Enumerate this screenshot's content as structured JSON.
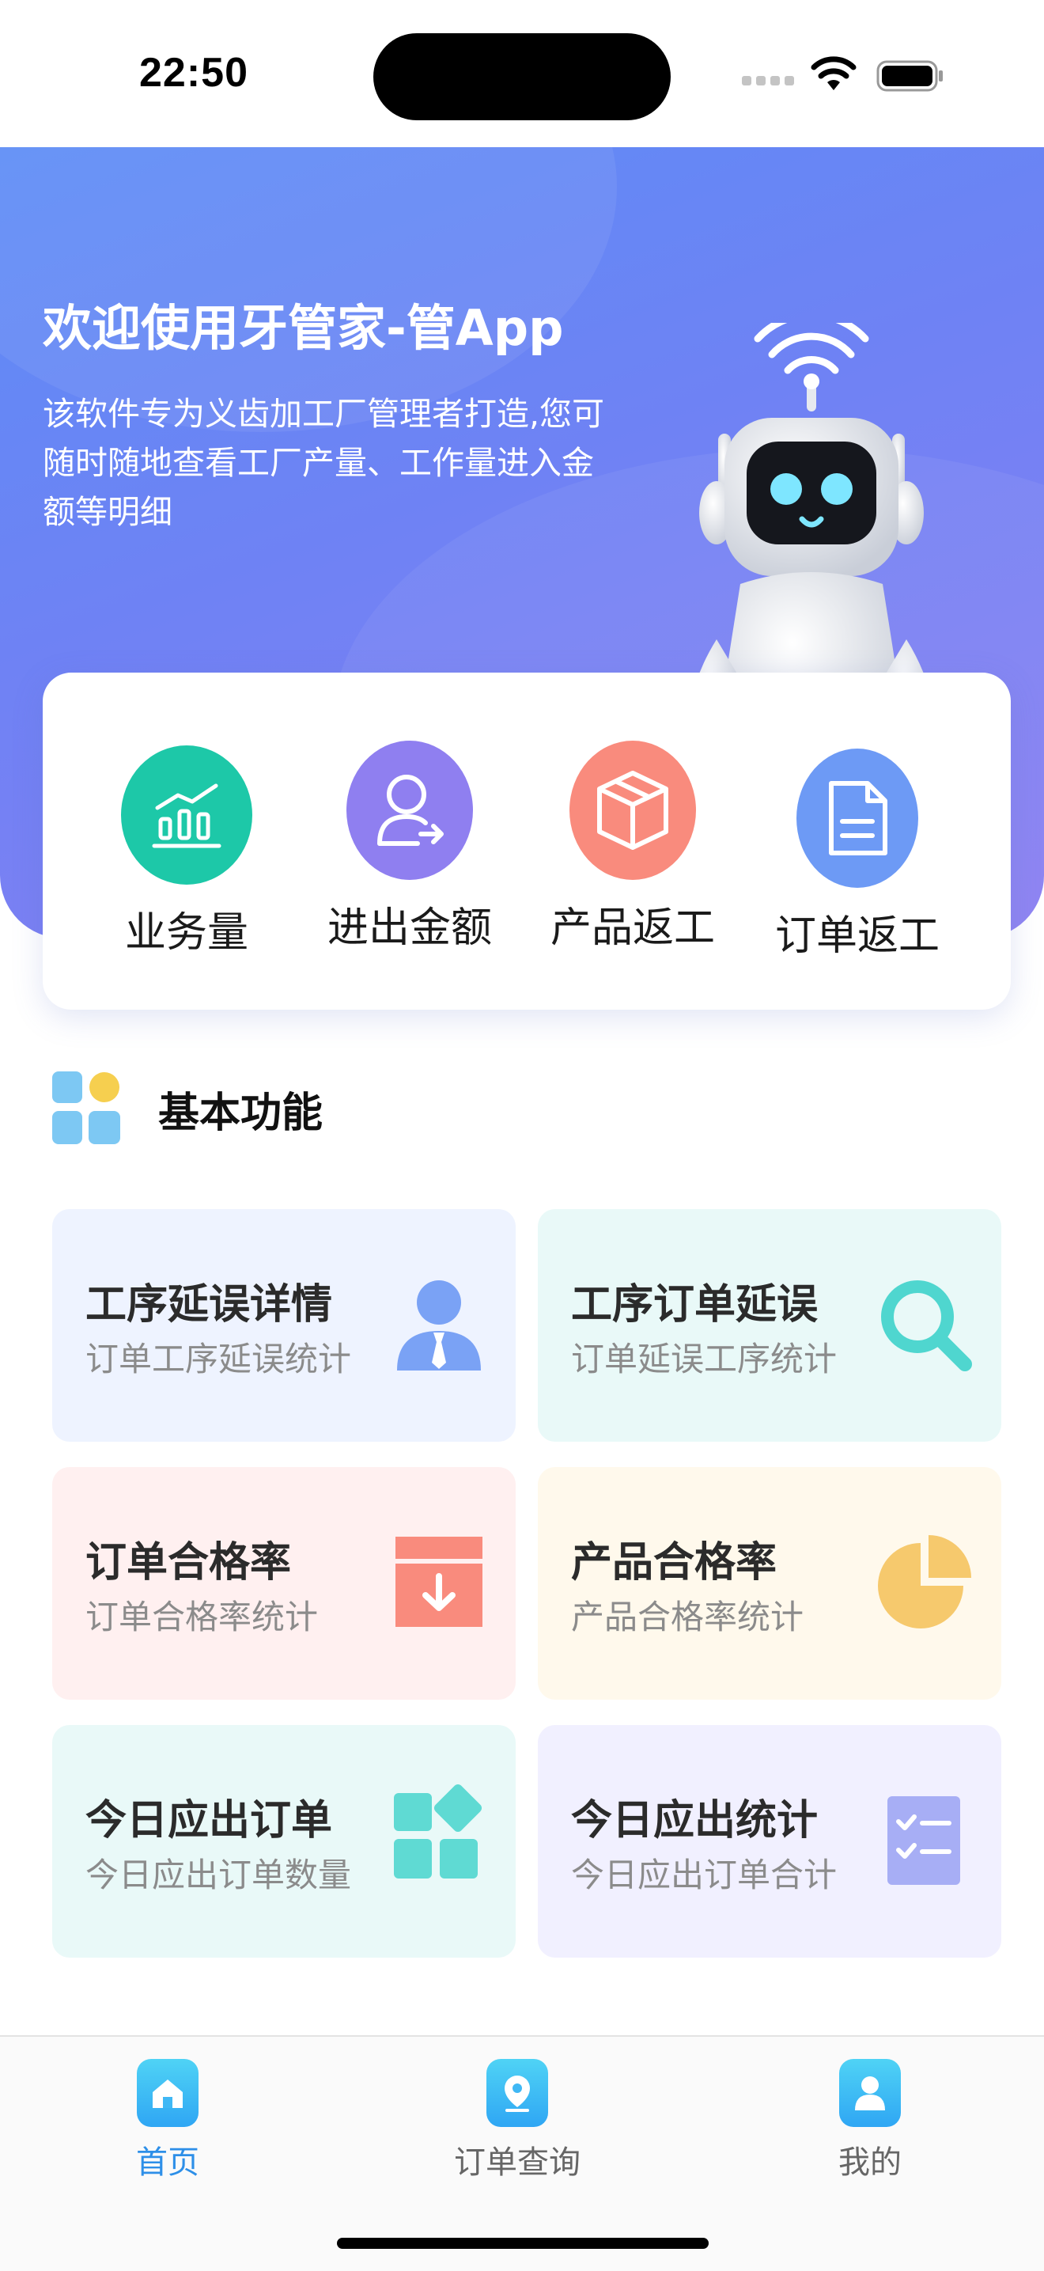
{
  "status_bar": {
    "time": "22:50"
  },
  "hero": {
    "title": "欢迎使用牙管家-管App",
    "description": "该软件专为义齿加工厂管理者打造,您可随时随地查看工厂产量、工作量进入金额等明细"
  },
  "quick_actions": [
    {
      "label": "业务量",
      "icon": "chart-bar-icon",
      "color": "#1dc8a8"
    },
    {
      "label": "进出金额",
      "icon": "user-transfer-icon",
      "color": "#8f7ff0"
    },
    {
      "label": "产品返工",
      "icon": "box-icon",
      "color": "#f98b7d"
    },
    {
      "label": "订单返工",
      "icon": "document-icon",
      "color": "#6d9af5"
    }
  ],
  "section": {
    "title": "基本功能"
  },
  "features": [
    {
      "title": "工序延误详情",
      "subtitle": "订单工序延误统计",
      "icon": "person-tie-icon",
      "bg": "#eef3ff",
      "color": "#7aa2f5"
    },
    {
      "title": "工序订单延误",
      "subtitle": "订单延误工序统计",
      "icon": "search-icon",
      "bg": "#e9f9f8",
      "color": "#4fd6cf"
    },
    {
      "title": "订单合格率",
      "subtitle": "订单合格率统计",
      "icon": "archive-down-icon",
      "bg": "#fff0f0",
      "color": "#f98b7d"
    },
    {
      "title": "产品合格率",
      "subtitle": "产品合格率统计",
      "icon": "pie-chart-icon",
      "bg": "#fff9ec",
      "color": "#f6c96d"
    },
    {
      "title": "今日应出订单",
      "subtitle": "今日应出订单数量",
      "icon": "blocks-icon",
      "bg": "#e9f9f8",
      "color": "#5fdad3"
    },
    {
      "title": "今日应出统计",
      "subtitle": "今日应出订单合计",
      "icon": "checklist-icon",
      "bg": "#f1f0ff",
      "color": "#a7aef5"
    }
  ],
  "tabs": [
    {
      "label": "首页",
      "icon": "home-icon",
      "active": true
    },
    {
      "label": "订单查询",
      "icon": "location-pin-icon",
      "active": false
    },
    {
      "label": "我的",
      "icon": "user-icon",
      "active": false
    }
  ]
}
